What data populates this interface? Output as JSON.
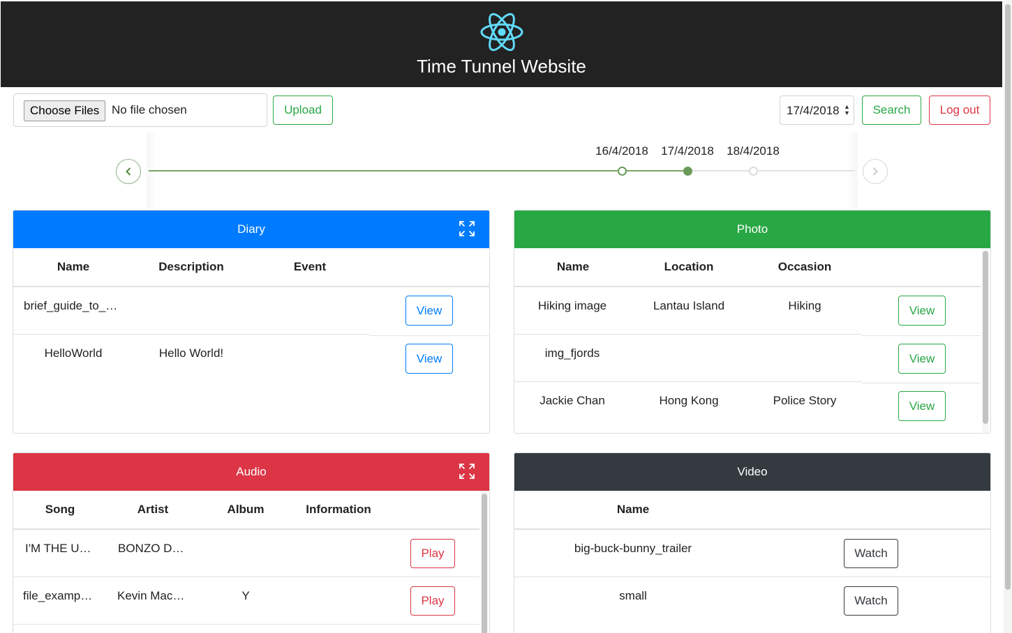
{
  "header": {
    "title": "Time Tunnel Website",
    "logo": "react-atom-icon"
  },
  "toolbar": {
    "choose_files_label": "Choose Files",
    "file_status": "No file chosen",
    "upload_label": "Upload",
    "date_value": "17/4/2018",
    "search_label": "Search",
    "logout_label": "Log out"
  },
  "timeline": {
    "dates": [
      "16/4/2018",
      "17/4/2018",
      "18/4/2018"
    ],
    "selected": "17/4/2018",
    "prev_icon": "chevron-left-icon",
    "next_icon": "chevron-right-icon"
  },
  "diary": {
    "title": "Diary",
    "columns": [
      "Name",
      "Description",
      "Event"
    ],
    "rows": [
      {
        "name": "brief_guide_to_…",
        "description": "",
        "event": "",
        "action": "View"
      },
      {
        "name": "HelloWorld",
        "description": "Hello World!",
        "event": "",
        "action": "View"
      }
    ]
  },
  "photo": {
    "title": "Photo",
    "columns": [
      "Name",
      "Location",
      "Occasion"
    ],
    "rows": [
      {
        "name": "Hiking image",
        "location": "Lantau Island",
        "occasion": "Hiking",
        "action": "View"
      },
      {
        "name": "img_fjords",
        "location": "",
        "occasion": "",
        "action": "View"
      },
      {
        "name": "Jackie Chan",
        "location": "Hong Kong",
        "occasion": "Police Story",
        "action": "View"
      }
    ]
  },
  "audio": {
    "title": "Audio",
    "columns": [
      "Song",
      "Artist",
      "Album",
      "Information"
    ],
    "rows": [
      {
        "song": "I'M THE U…",
        "artist": "BONZO D…",
        "album": "",
        "information": "",
        "action": "Play"
      },
      {
        "song": "file_examp…",
        "artist": "Kevin Mac…",
        "album": "Y",
        "information": "",
        "action": "Play"
      }
    ]
  },
  "video": {
    "title": "Video",
    "columns": [
      "Name"
    ],
    "rows": [
      {
        "name": "big-buck-bunny_trailer",
        "action": "Watch"
      },
      {
        "name": "small",
        "action": "Watch"
      }
    ]
  },
  "colors": {
    "header_bg": "#222222",
    "diary": "#007bff",
    "photo": "#28a745",
    "audio": "#dc3545",
    "video": "#343a40",
    "timeline": "#6a9a5a"
  }
}
